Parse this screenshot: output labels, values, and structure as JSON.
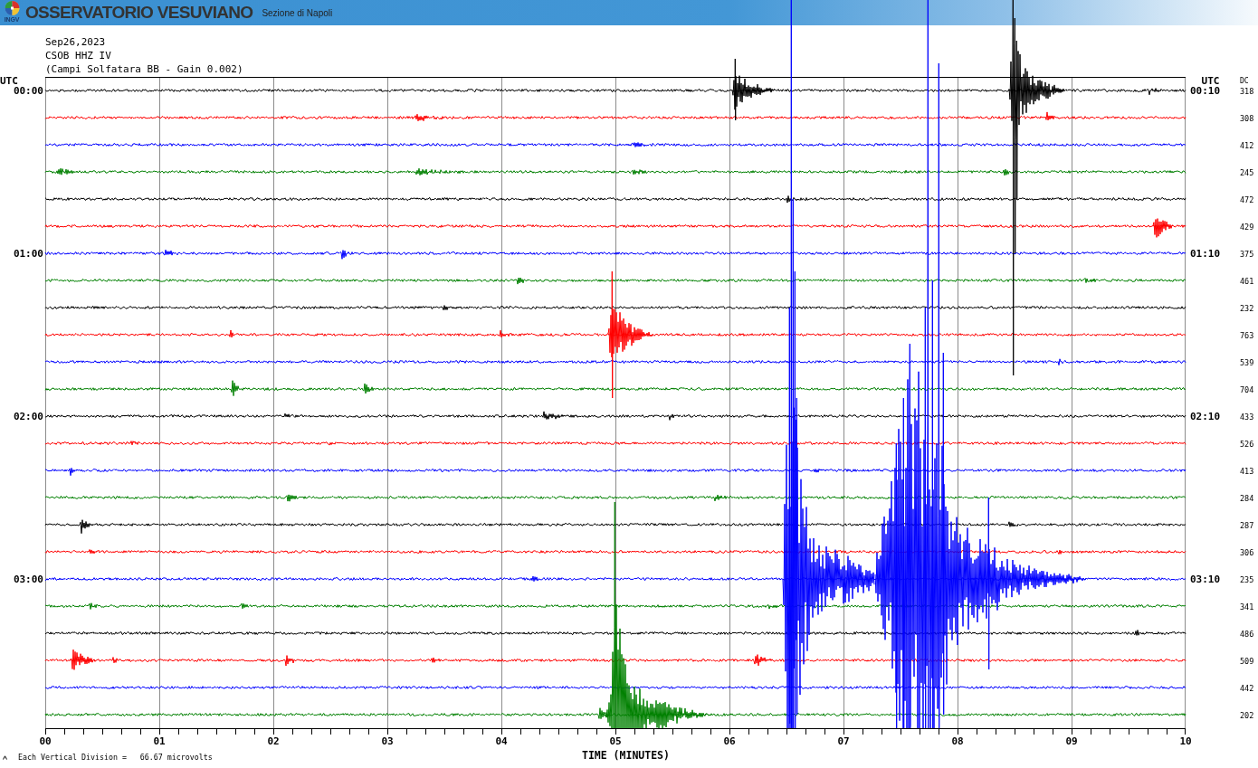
{
  "header": {
    "logo_text": "INGV",
    "title": "OSSERVATORIO VESUVIANO",
    "subtitle": "Sezione di Napoli"
  },
  "chart_info": {
    "date": "Sep26,2023",
    "station": "CSOB HHZ IV",
    "description": "(Campi Solfatara BB - Gain 0.002)"
  },
  "left_axis": {
    "title": "UTC"
  },
  "right_axis": {
    "title": "UTC"
  },
  "dc_column": {
    "title": "DC"
  },
  "traces": [
    {
      "color": "#000000",
      "start_time": "00:00",
      "end_time": "00:10",
      "dc": "318"
    },
    {
      "color": "#ff0000",
      "dc": "308"
    },
    {
      "color": "#0000ff",
      "dc": "412"
    },
    {
      "color": "#008000",
      "dc": "245"
    },
    {
      "color": "#000000",
      "dc": "472"
    },
    {
      "color": "#ff0000",
      "dc": "429"
    },
    {
      "color": "#0000ff",
      "start_time": "01:00",
      "end_time": "01:10",
      "dc": "375"
    },
    {
      "color": "#008000",
      "dc": "461"
    },
    {
      "color": "#000000",
      "dc": "232"
    },
    {
      "color": "#ff0000",
      "dc": "763"
    },
    {
      "color": "#0000ff",
      "dc": "539"
    },
    {
      "color": "#008000",
      "dc": "704"
    },
    {
      "color": "#000000",
      "start_time": "02:00",
      "end_time": "02:10",
      "dc": "433"
    },
    {
      "color": "#ff0000",
      "dc": "526"
    },
    {
      "color": "#0000ff",
      "dc": "413"
    },
    {
      "color": "#008000",
      "dc": "284"
    },
    {
      "color": "#000000",
      "dc": "287"
    },
    {
      "color": "#ff0000",
      "dc": "306"
    },
    {
      "color": "#0000ff",
      "start_time": "03:00",
      "end_time": "03:10",
      "dc": "235"
    },
    {
      "color": "#008000",
      "dc": "341"
    },
    {
      "color": "#000000",
      "dc": "486"
    },
    {
      "color": "#ff0000",
      "dc": "509"
    },
    {
      "color": "#0000ff",
      "dc": "442"
    },
    {
      "color": "#008000",
      "dc": "202"
    }
  ],
  "x_axis": {
    "ticks": [
      "00",
      "01",
      "02",
      "03",
      "04",
      "05",
      "06",
      "07",
      "08",
      "09",
      "10"
    ],
    "title": "TIME (MINUTES)"
  },
  "footer": {
    "scale_note": "Each Vertical Division =   66.67 microvolts"
  }
}
